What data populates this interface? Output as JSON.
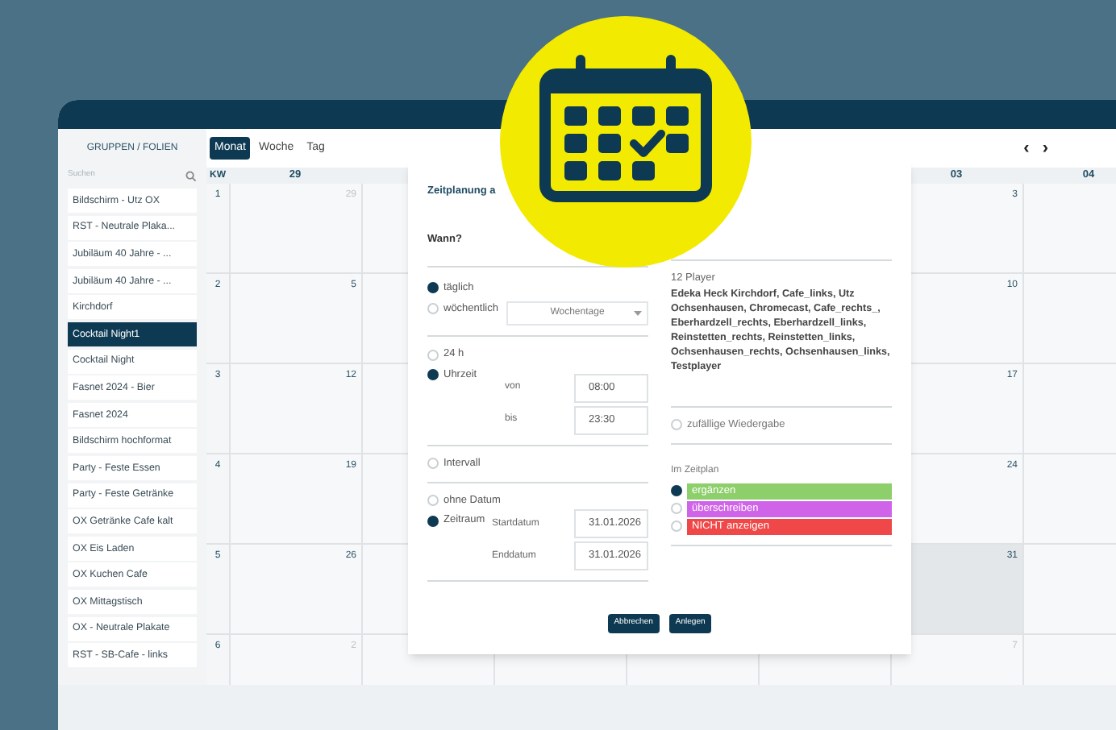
{
  "sidebar": {
    "title": "GRUPPEN / FOLIEN",
    "search": {
      "placeholder": "Suchen"
    },
    "items": [
      {
        "label": "Bildschirm - Utz OX",
        "selected": false
      },
      {
        "label": "RST - Neutrale Plaka...",
        "selected": false
      },
      {
        "label": "Jubiläum 40 Jahre - ...",
        "selected": false
      },
      {
        "label": "Jubiläum 40 Jahre - ...",
        "selected": false
      },
      {
        "label": "Kirchdorf",
        "selected": false
      },
      {
        "label": "Cocktail Night1",
        "selected": true
      },
      {
        "label": "Cocktail Night",
        "selected": false
      },
      {
        "label": "Fasnet 2024 - Bier",
        "selected": false
      },
      {
        "label": "Fasnet 2024",
        "selected": false
      },
      {
        "label": "Bildschirm hochformat",
        "selected": false
      },
      {
        "label": "Party - Feste Essen",
        "selected": false
      },
      {
        "label": "Party - Feste Getränke",
        "selected": false
      },
      {
        "label": "OX Getränke Cafe kalt",
        "selected": false
      },
      {
        "label": "OX Eis Laden",
        "selected": false
      },
      {
        "label": "OX Kuchen Cafe",
        "selected": false
      },
      {
        "label": "OX Mittagstisch",
        "selected": false
      },
      {
        "label": "OX - Neutrale Plakate",
        "selected": false
      },
      {
        "label": "RST - SB-Cafe - links",
        "selected": false
      }
    ]
  },
  "views": [
    {
      "label": "Monat",
      "selected": true
    },
    {
      "label": "Woche",
      "selected": false
    },
    {
      "label": "Tag",
      "selected": false
    }
  ],
  "nav": [
    "‹",
    "›"
  ],
  "calendar": {
    "kw_label": "KW",
    "columns": [
      "29",
      "03",
      "04"
    ],
    "weeks": [
      {
        "kw": "1",
        "days": [
          {
            "text": "29",
            "muted": true,
            "highlighted": false
          },
          {
            "text": "3",
            "muted": false,
            "highlighted": false
          }
        ]
      },
      {
        "kw": "2",
        "days": [
          {
            "text": "5",
            "muted": false,
            "highlighted": false
          },
          {
            "text": "10",
            "muted": false,
            "highlighted": false
          }
        ]
      },
      {
        "kw": "3",
        "days": [
          {
            "text": "12",
            "muted": false,
            "highlighted": false
          },
          {
            "text": "17",
            "muted": false,
            "highlighted": false
          }
        ]
      },
      {
        "kw": "4",
        "days": [
          {
            "text": "19",
            "muted": false,
            "highlighted": false
          },
          {
            "text": "24",
            "muted": false,
            "highlighted": false
          }
        ]
      },
      {
        "kw": "5",
        "days": [
          {
            "text": "26",
            "muted": false,
            "highlighted": false
          },
          {
            "text": "31",
            "muted": false,
            "highlighted": true
          }
        ]
      },
      {
        "kw": "6",
        "days": [
          {
            "text": "2",
            "muted": true,
            "highlighted": false
          },
          {
            "text": "7",
            "muted": true,
            "highlighted": false
          }
        ]
      }
    ]
  },
  "dialog": {
    "title": "Zeitplanung a",
    "when": {
      "heading": "Wann?",
      "repeat": [
        {
          "label": "täglich",
          "selected": true
        },
        {
          "label": "wöchentlich",
          "selected": false
        }
      ],
      "weekday_select": "Wochentage",
      "time": [
        {
          "label": "24 h",
          "selected": false
        },
        {
          "label": "Uhrzeit",
          "selected": true
        }
      ],
      "from_label": "von",
      "from_value": "08:00",
      "to_label": "bis",
      "to_value": "23:30",
      "interval": {
        "label": "Intervall",
        "checked": false
      },
      "date": [
        {
          "label": "ohne Datum",
          "selected": false
        },
        {
          "label": "Zeitraum",
          "selected": true
        }
      ],
      "start_label": "Startdatum",
      "start_value": "31.01.2026",
      "end_label": "Enddatum",
      "end_value": "31.01.2026"
    },
    "players": {
      "count": "12 Player",
      "list": "Edeka Heck Kirchdorf, Cafe_links, Utz Ochsenhausen, Chromecast, Cafe_rechts_, Eberhardzell_rechts, Eberhardzell_links, Reinstetten_rechts, Reinstetten_links, Ochsenhausen_rechts, Ochsenhausen_links, Testplayer",
      "shuffle": {
        "label": "zufällige Wiedergabe",
        "checked": false
      },
      "schedule_heading": "Im Zeitplan",
      "modes": [
        {
          "label": "ergänzen",
          "selected": true,
          "color": "#8dcf6a"
        },
        {
          "label": "überschreiben",
          "selected": false,
          "color": "#d064e8"
        },
        {
          "label": "NICHT anzeigen",
          "selected": false,
          "color": "#f04848"
        }
      ]
    },
    "buttons": [
      "Abbrechen",
      "Anlegen"
    ]
  }
}
